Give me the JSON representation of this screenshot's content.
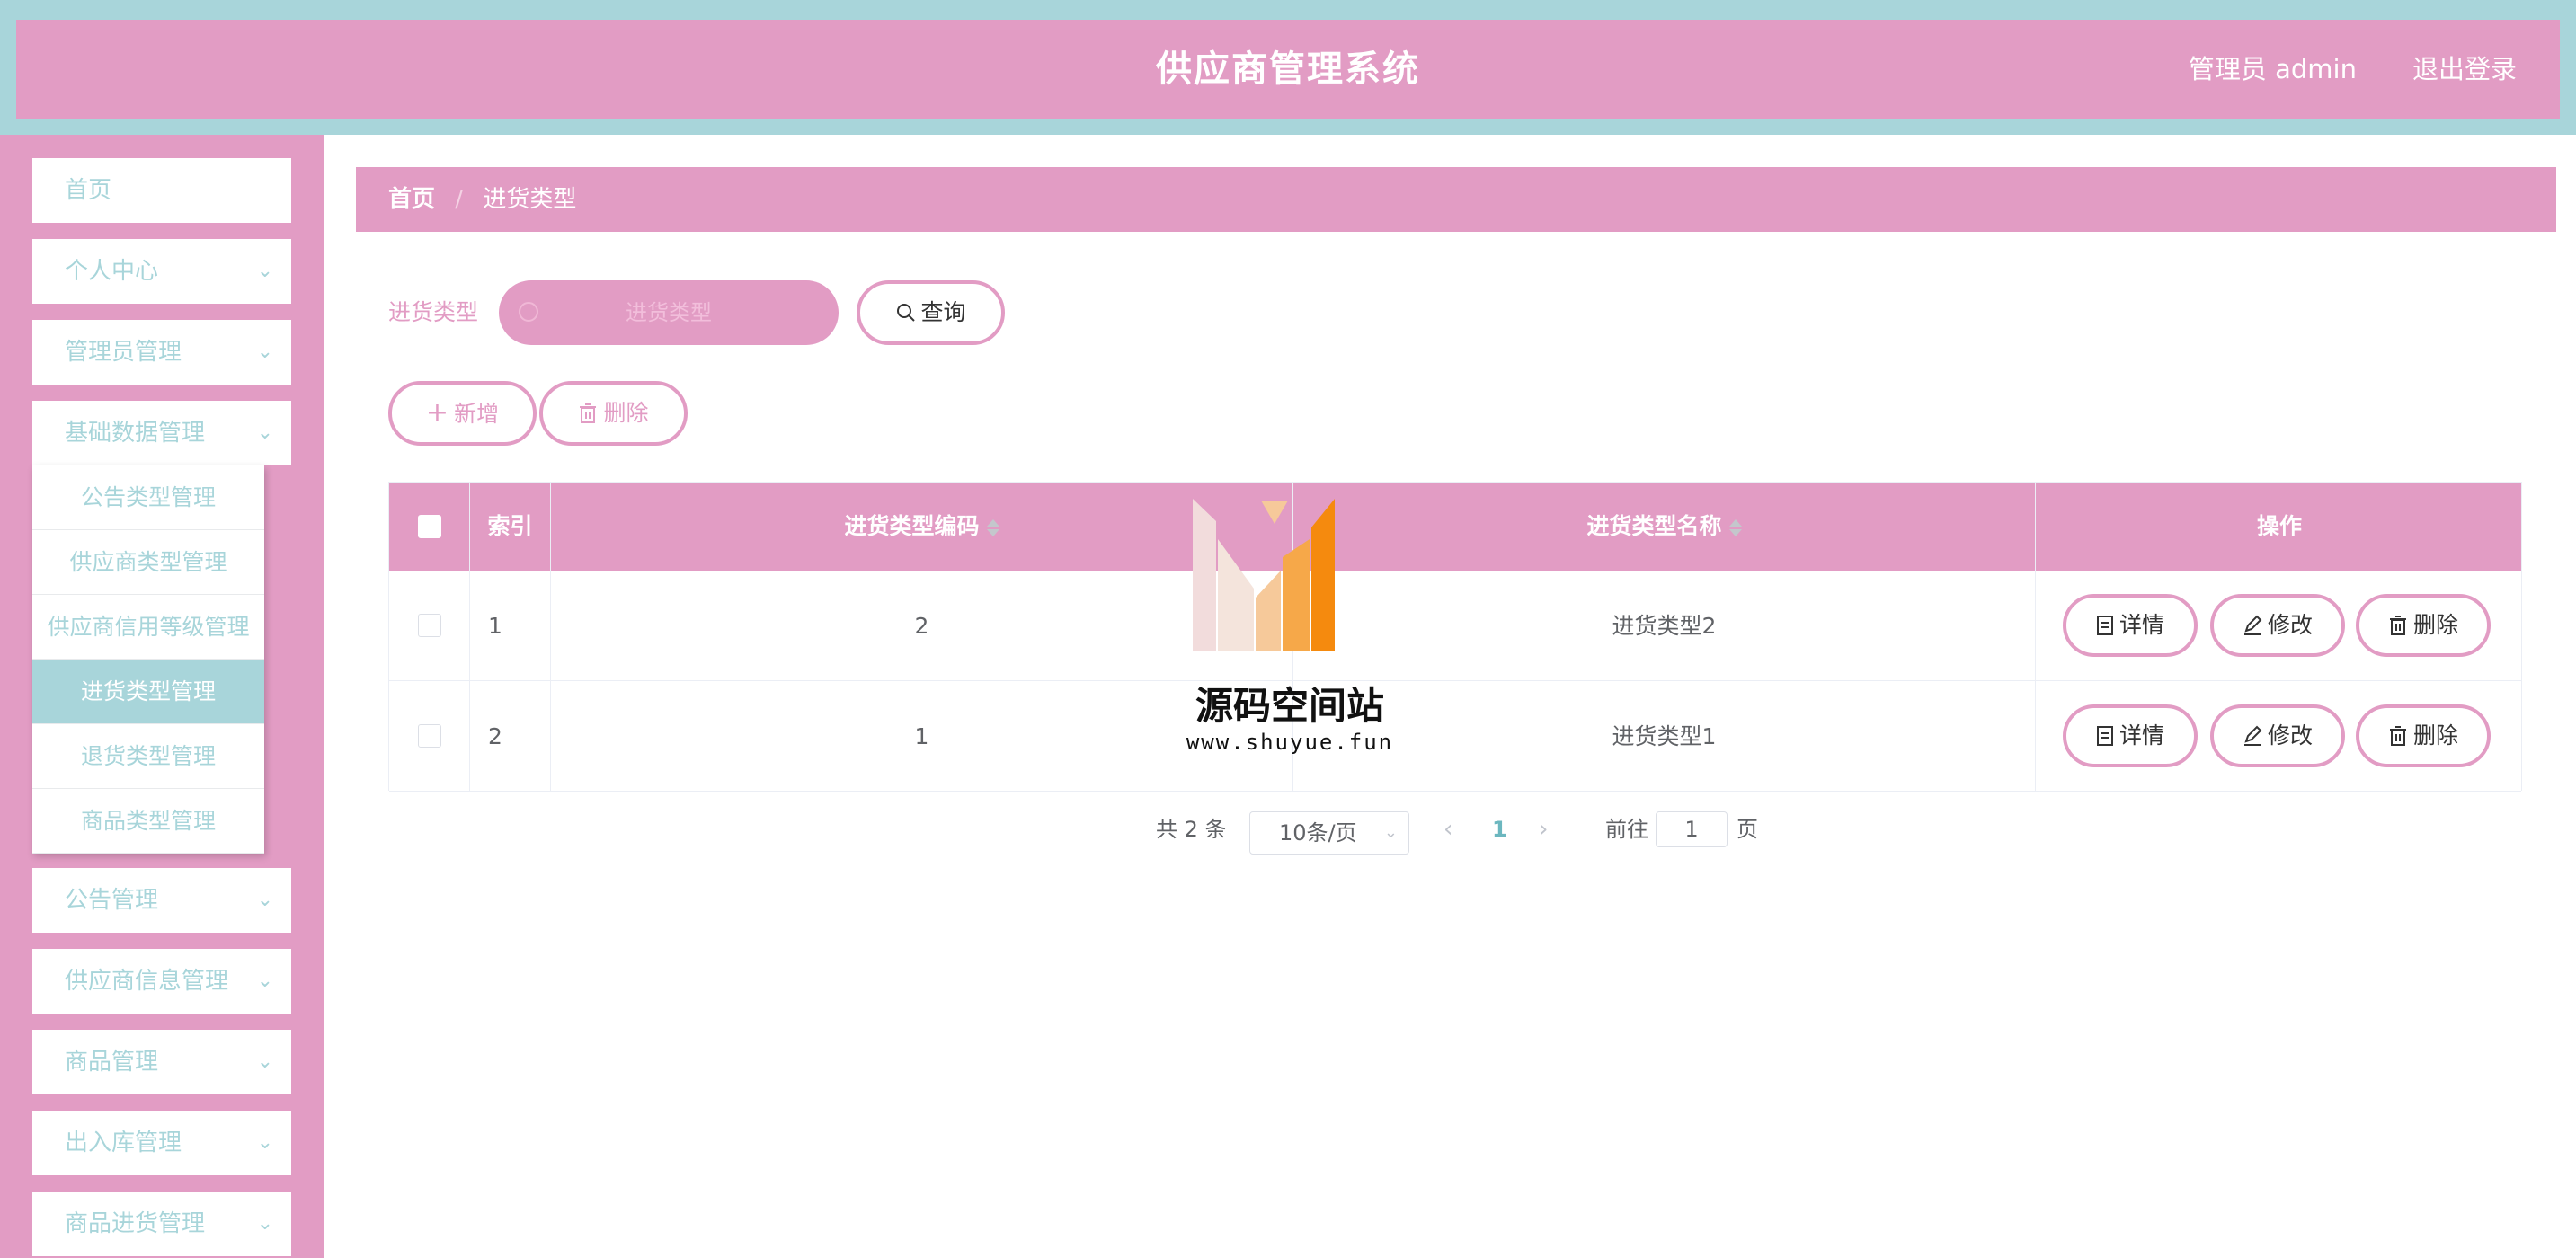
{
  "header": {
    "title": "供应商管理系统",
    "user": "管理员 admin",
    "logout": "退出登录"
  },
  "sidebar": {
    "items": [
      {
        "label": "首页"
      },
      {
        "label": "个人中心"
      },
      {
        "label": "管理员管理"
      },
      {
        "label": "基础数据管理"
      },
      {
        "label": "公告管理"
      },
      {
        "label": "供应商信息管理"
      },
      {
        "label": "商品管理"
      },
      {
        "label": "出入库管理"
      },
      {
        "label": "商品进货管理"
      }
    ],
    "submenu": [
      {
        "label": "公告类型管理"
      },
      {
        "label": "供应商类型管理"
      },
      {
        "label": "供应商信用等级管理"
      },
      {
        "label": "进货类型管理",
        "active": true
      },
      {
        "label": "退货类型管理"
      },
      {
        "label": "商品类型管理"
      }
    ]
  },
  "breadcrumb": {
    "home": "首页",
    "separator": "/",
    "current": "进货类型"
  },
  "search": {
    "label": "进货类型",
    "placeholder": "进货类型",
    "query_button": "查询"
  },
  "toolbar": {
    "add": "新增",
    "delete": "删除"
  },
  "table": {
    "columns": {
      "index": "索引",
      "code": "进货类型编码",
      "name": "进货类型名称",
      "actions": "操作"
    },
    "rows": [
      {
        "index": "1",
        "code": "2",
        "name": "进货类型2"
      },
      {
        "index": "2",
        "code": "1",
        "name": "进货类型1"
      }
    ],
    "row_actions": {
      "detail": "详情",
      "edit": "修改",
      "delete": "删除"
    }
  },
  "pagination": {
    "total": "共 2 条",
    "page_size": "10条/页",
    "current_page": "1",
    "goto_label": "前往",
    "goto_value": "1",
    "goto_unit": "页"
  },
  "watermark": {
    "title": "源码空间站",
    "url": "www.shuyue.fun"
  },
  "colors": {
    "primary_pink": "#e29cc4",
    "accent_teal": "#a8d5da",
    "white": "#ffffff"
  }
}
